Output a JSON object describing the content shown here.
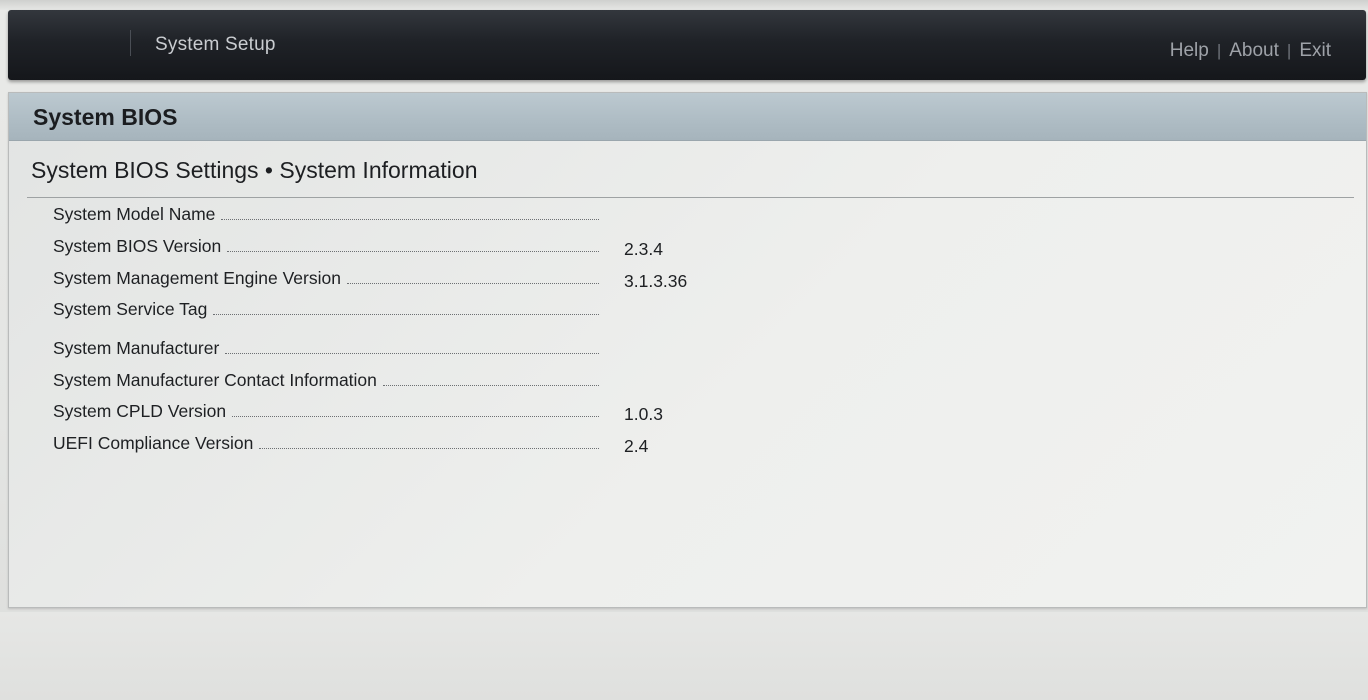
{
  "header": {
    "app_title": "System Setup",
    "nav": {
      "help": "Help",
      "about": "About",
      "exit": "Exit",
      "separator": "|"
    }
  },
  "panel": {
    "title": "System BIOS",
    "section_title": "System BIOS Settings • System Information"
  },
  "rows": [
    {
      "label": "System Model Name",
      "value": ""
    },
    {
      "label": "System BIOS Version",
      "value": "2.3.4"
    },
    {
      "label": "System Management Engine Version",
      "value": "3.1.3.36"
    },
    {
      "label": "System Service Tag",
      "value": ""
    },
    {
      "label": "System Manufacturer",
      "value": ""
    },
    {
      "label": "System Manufacturer Contact Information",
      "value": ""
    },
    {
      "label": "System CPLD Version",
      "value": "1.0.3"
    },
    {
      "label": "UEFI Compliance Version",
      "value": "2.4"
    }
  ],
  "colors": {
    "top_bar": "#1f2227",
    "panel_header": "#aebcc4",
    "panel_bg": "#eeefed",
    "text": "#1e2023"
  }
}
